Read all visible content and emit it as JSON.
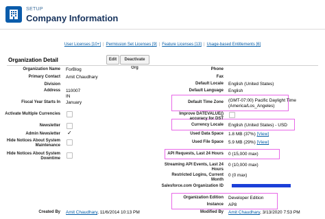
{
  "header": {
    "section_label": "SETUP",
    "title": "Company Information",
    "icon": "building-icon",
    "icon_bg": "#0b5cab"
  },
  "links": [
    {
      "label": "User Licenses [10+]"
    },
    {
      "label": "Permission Set Licenses [9]"
    },
    {
      "label": "Feature Licenses [13]"
    },
    {
      "label": "Usage-based Entitlements [6]"
    }
  ],
  "detail": {
    "title": "Organization Detail",
    "edit_label": "Edit",
    "deactivate_label": "Deactivate Org"
  },
  "left": {
    "org_name": {
      "label": "Organization Name",
      "value": "ForBlog"
    },
    "primary_contact": {
      "label": "Primary Contact",
      "value": "Amit Chaudhary"
    },
    "division": {
      "label": "Division",
      "value": ""
    },
    "address": {
      "label": "Address",
      "line1": "110007",
      "line2": "IN"
    },
    "fiscal_year": {
      "label": "Fiscal Year Starts In",
      "value": "January"
    },
    "multi_currency": {
      "label": "Activate Multiple Currencies"
    },
    "newsletter": {
      "label": "Newsletter"
    },
    "admin_newsletter": {
      "label": "Admin Newsletter",
      "value": "✓"
    },
    "hide_notices_maint": {
      "label": "Hide Notices About System Maintenance"
    },
    "hide_notices_down": {
      "label": "Hide Notices About System Downtime"
    },
    "created_by": {
      "label": "Created By",
      "user": "Amit Chaudhary",
      "date": ", 11/6/2014 10:13 PM"
    }
  },
  "right": {
    "phone": {
      "label": "Phone",
      "value": ""
    },
    "fax": {
      "label": "Fax",
      "value": ""
    },
    "default_locale": {
      "label": "Default Locale",
      "value": "English (United States)"
    },
    "default_language": {
      "label": "Default Language",
      "value": "English"
    },
    "time_zone": {
      "label": "Default Time Zone",
      "line1": "(GMT-07:00) Pacific Daylight Time",
      "line2": "(America/Los_Angeles)"
    },
    "improve_datevalue": {
      "label": "Improve DATEVALUE() accuracy for DST"
    },
    "currency_locale": {
      "label": "Currency Locale",
      "value": "English (United States) - USD"
    },
    "data_space": {
      "label": "Used Data Space",
      "value": "1.8 MB (37%)",
      "link": "[View]"
    },
    "file_space": {
      "label": "Used File Space",
      "value": "5.9 MB (29%)",
      "link": "[View]"
    },
    "api_requests": {
      "label": "API Requests, Last 24 Hours",
      "value": "0 (15,000 max)"
    },
    "streaming_api": {
      "label": "Streaming API Events, Last 24 Hours",
      "value": "0 (10,000 max)"
    },
    "restricted_logins": {
      "label": "Restricted Logins, Current Month",
      "value": "0 (0 max)"
    },
    "org_id": {
      "label": "Salesforce.com Organization ID"
    },
    "org_edition": {
      "label": "Organization Edition",
      "value": "Developer Edition"
    },
    "instance": {
      "label": "Instance",
      "value": "AP8"
    },
    "modified_by": {
      "label": "Modified By",
      "user": "Amit Chaudhary",
      "date": ", 3/13/2020 7:53 PM"
    }
  },
  "colors": {
    "highlight": "#e866e8",
    "link": "#015ba7",
    "redaction": "#1b3fd8"
  }
}
